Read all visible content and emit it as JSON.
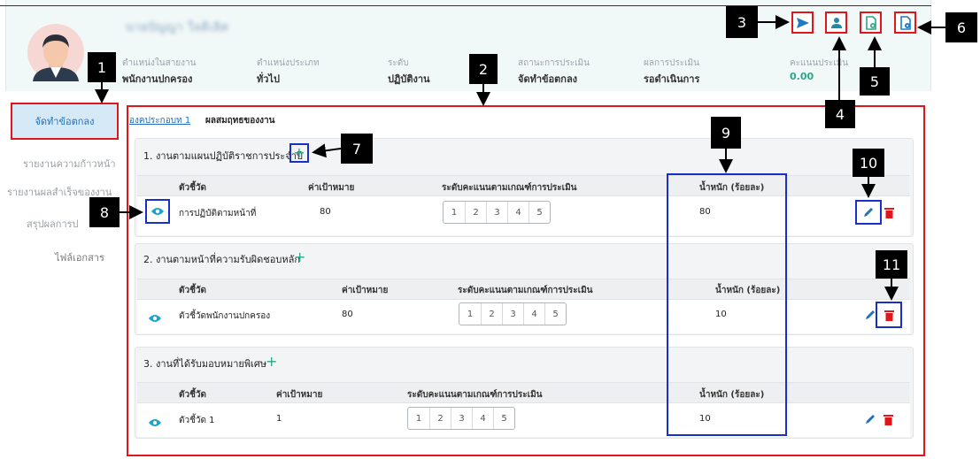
{
  "header": {
    "user_name": "นายปัญญา ใจดีเลิศ",
    "fields": [
      {
        "label": "ตำแหน่งในสายงาน",
        "value": "พนักงานปกครอง"
      },
      {
        "label": "ตำแหน่งประเภท",
        "value": "ทั่วไป"
      },
      {
        "label": "ระดับ",
        "value": "ปฏิบัติงาน"
      },
      {
        "label": "สถานะการประเมิน",
        "value": "จัดทำข้อตกลง"
      },
      {
        "label": "ผลการประเมิน",
        "value": "รอดำเนินการ"
      },
      {
        "label": "คะแนนประเมิน",
        "value": "0.00"
      }
    ]
  },
  "toolbar": {
    "icons": [
      "send-icon",
      "user-icon",
      "document-add-icon",
      "document-settings-icon"
    ]
  },
  "sidebar": {
    "items": [
      {
        "label": "จัดทำข้อตกลง"
      },
      {
        "label": "รายงานความก้าวหน้า"
      },
      {
        "label": "รายงานผลสำเร็จของงาน"
      },
      {
        "label": "สรุปผลการป"
      },
      {
        "label": "ไฟล์เอกสาร"
      }
    ]
  },
  "main": {
    "breadcrumb_link": "องคประกอบท 1",
    "breadcrumb_title": "ผลสมฤทธของงาน",
    "sections": [
      {
        "title": "1. งานตามแผนปฏิบัติราชการประจำปี",
        "headers": [
          "ตัวชี้วัด",
          "ค่าเป้าหมาย",
          "ระดับคะแนนตามเกณฑ์การประเมิน",
          "น้ำหนัก (ร้อยละ)"
        ],
        "row": {
          "indicator": "การปฏิบัติตามหน้าที่",
          "target": "80",
          "scale": [
            "1",
            "2",
            "3",
            "4",
            "5"
          ],
          "weight": "80"
        }
      },
      {
        "title": "2. งานตามหน้าที่ความรับผิดชอบหลัก",
        "headers": [
          "ตัวชี้วัด",
          "ค่าเป้าหมาย",
          "ระดับคะแนนตามเกณฑ์การประเมิน",
          "น้ำหนัก (ร้อยละ)"
        ],
        "row": {
          "indicator": "ตัวชี้วัดพนักงานปกครอง",
          "target": "80",
          "scale": [
            "1",
            "2",
            "3",
            "4",
            "5"
          ],
          "weight": "10"
        }
      },
      {
        "title": "3. งานที่ได้รับมอบหมายพิเศษ",
        "headers": [
          "ตัวชี้วัด",
          "ค่าเป้าหมาย",
          "ระดับคะแนนตามเกณฑ์การประเมิน",
          "น้ำหนัก (ร้อยละ)"
        ],
        "row": {
          "indicator": "ตัวชี้วัด 1",
          "target": "1",
          "scale": [
            "1",
            "2",
            "3",
            "4",
            "5"
          ],
          "weight": "10"
        }
      }
    ]
  },
  "callouts": [
    "1",
    "2",
    "3",
    "4",
    "5",
    "6",
    "7",
    "8",
    "9",
    "10",
    "11"
  ],
  "colors": {
    "accent_red": "#e0161b",
    "accent_blue": "#1a2fc8",
    "teal": "#2ea58a",
    "link_blue": "#1f6fbd"
  }
}
